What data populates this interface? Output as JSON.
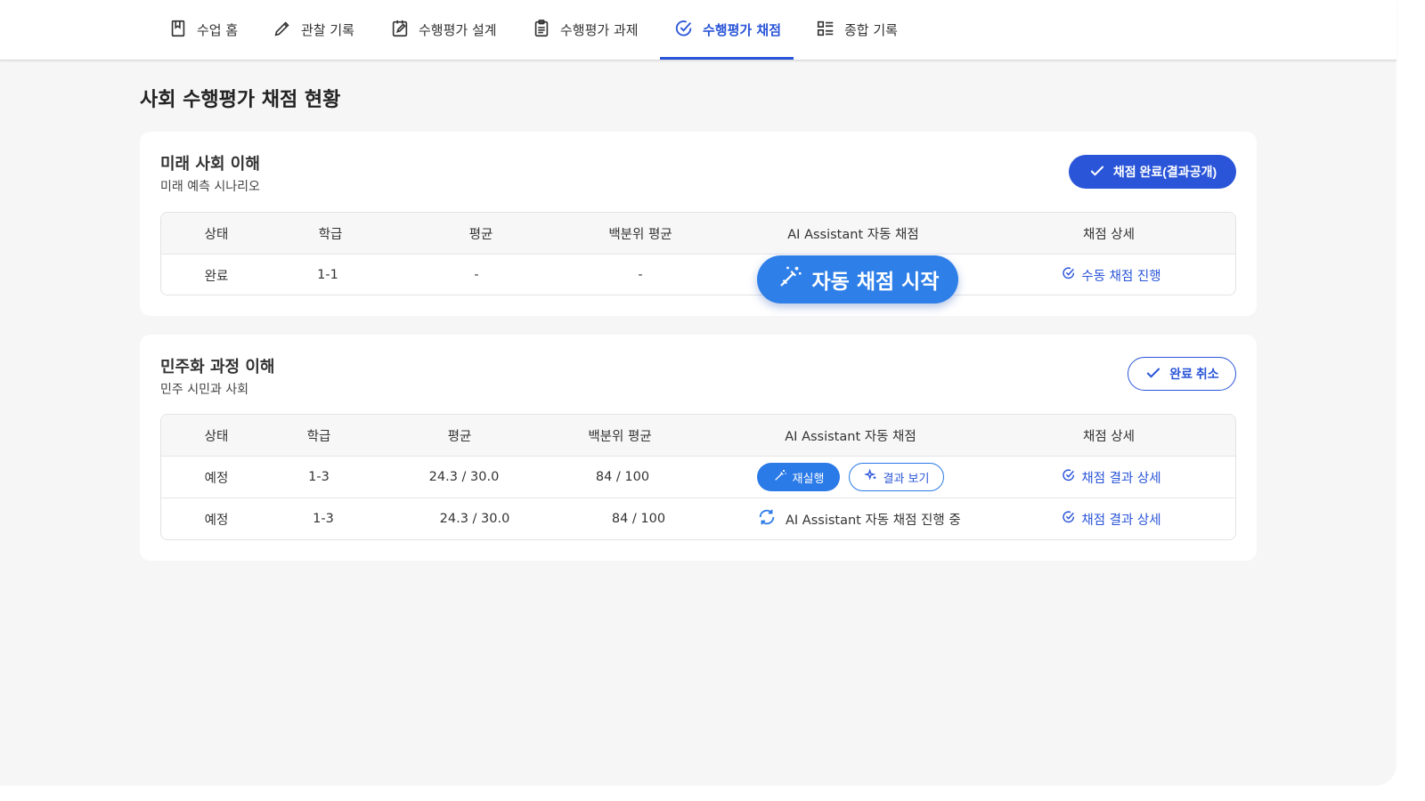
{
  "nav": {
    "tabs": [
      {
        "label": "수업 홈",
        "icon": "bookmark-book-icon",
        "active": false
      },
      {
        "label": "관찰 기록",
        "icon": "pencil-icon",
        "active": false
      },
      {
        "label": "수행평가 설계",
        "icon": "edit-square-icon",
        "active": false
      },
      {
        "label": "수행평가 과제",
        "icon": "clipboard-icon",
        "active": false
      },
      {
        "label": "수행평가 채점",
        "icon": "check-circle-icon",
        "active": true
      },
      {
        "label": "종합 기록",
        "icon": "list-view-icon",
        "active": false
      }
    ]
  },
  "page": {
    "title": "사회 수행평가 채점 현황"
  },
  "colors": {
    "accent": "#2a55d8",
    "float": "#2e7fe8"
  },
  "cards": [
    {
      "title": "미래 사회 이해",
      "subtitle": "미래 예측 시나리오",
      "action_label": "채점 완료(결과공개)",
      "headers": [
        "상태",
        "학급",
        "평균",
        "백분위 평균",
        "AI Assistant 자동 채점",
        "채점 상세"
      ],
      "rows": [
        {
          "status": "완료",
          "class": "1-1",
          "avg": "-",
          "pct": "-",
          "detail": "수동 채점 진행"
        }
      ]
    },
    {
      "title": "민주화 과정 이해",
      "subtitle": "민주 시민과 사회",
      "action_label": "완료 취소",
      "headers": [
        "상태",
        "학급",
        "평균",
        "백분위 평균",
        "AI Assistant 자동 채점",
        "채점 상세"
      ],
      "rows": [
        {
          "status": "예정",
          "class": "1-3",
          "avg": "24.3 / 30.0",
          "pct": "84 / 100",
          "rerun": "재실행",
          "view": "결과 보기",
          "detail": "채점 결과 상세"
        },
        {
          "status": "예정",
          "class": "1-3",
          "avg": "24.3 / 30.0",
          "pct": "84 / 100",
          "progress": "AI Assistant 자동 채점 진행 중",
          "detail": "채점 결과 상세"
        }
      ]
    }
  ],
  "float_button": {
    "label": "자동 채점 시작"
  }
}
